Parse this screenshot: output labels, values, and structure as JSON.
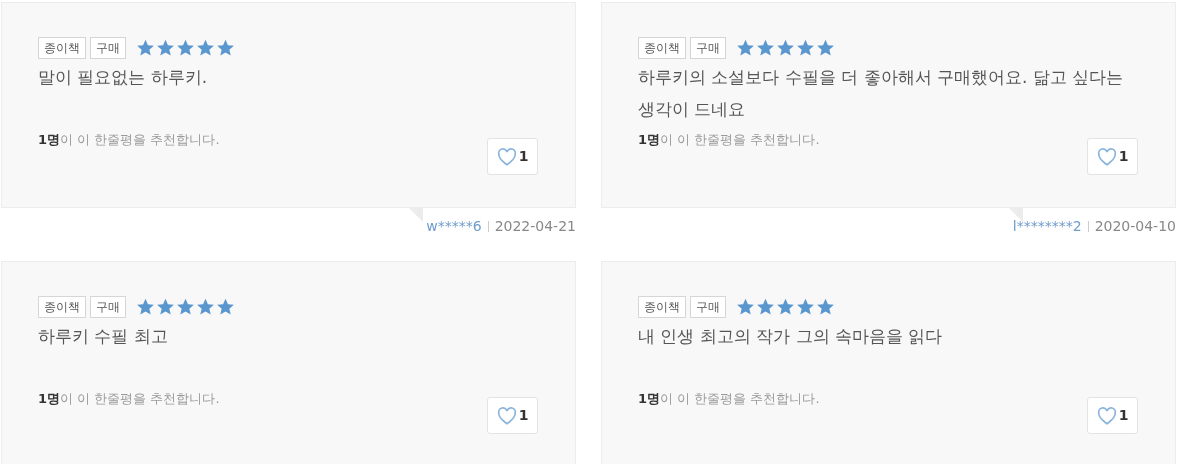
{
  "reviews": [
    {
      "tags": [
        "종이책",
        "구매"
      ],
      "stars": 5,
      "text": "말이 필요없는 하루키.",
      "recommend": "**1명**이 이 한줄평을 추천합니다.",
      "likes": "1",
      "author": "w*****6",
      "date": "2022-04-21"
    },
    {
      "tags": [
        "종이책",
        "구매"
      ],
      "stars": 5,
      "text": "하루키의 소설보다 수필을 더 좋아해서 구매했어요. 닮고 싶다는 생각이 드네요",
      "recommend": "**1명**이 이 한줄평을 추천합니다.",
      "likes": "1",
      "author": "l********2",
      "date": "2020-04-10"
    },
    {
      "tags": [
        "종이책",
        "구매"
      ],
      "stars": 5,
      "text": "하루키 수필 최고",
      "recommend": "**1명**이 이 한줄평을 추천합니다.",
      "likes": "1"
    },
    {
      "tags": [
        "종이책",
        "구매"
      ],
      "stars": 5,
      "text": "내 인생 최고의 작가 그의 속마음을 읽다",
      "recommend": "**1명**이 이 한줄평을 추천합니다.",
      "likes": "1"
    }
  ]
}
